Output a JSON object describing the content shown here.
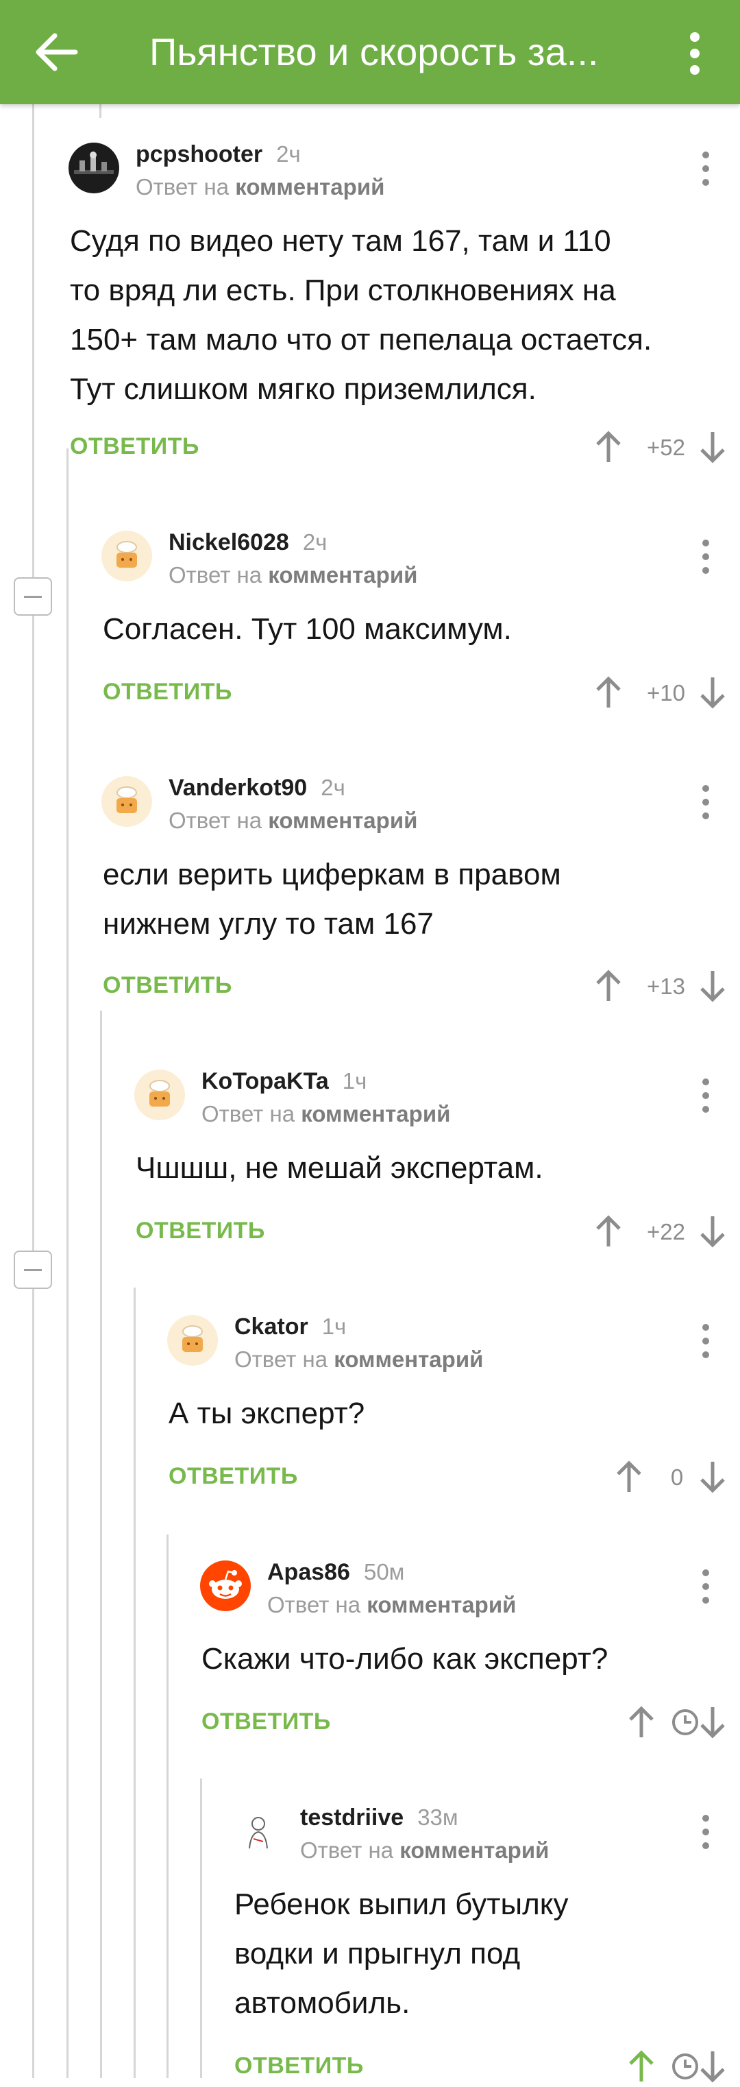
{
  "header": {
    "title": "Пьянство и скорость за...",
    "back_icon": "arrow-left-icon",
    "menu_icon": "more-vertical-icon",
    "color": "#6fae45"
  },
  "colors": {
    "accent": "#78b94c",
    "muted": "#9b9b9b",
    "line": "#d6d6d6"
  },
  "comments": [
    {
      "author": "pcpshooter",
      "time": "2ч",
      "reply_prefix": "Ответ на",
      "reply_link": "комментарий",
      "body": [
        "Судя по видео нету там 167, там и 110",
        "то вряд ли есть. При столкновениях на",
        "150+ там мало что от пепелаца остается.",
        "Тут слишком мягко приземлился."
      ],
      "action": "ОТВЕТИТЬ",
      "score": "+52"
    },
    {
      "author": "Nickel6028",
      "time": "2ч",
      "reply_prefix": "Ответ на",
      "reply_link": "комментарий",
      "body": [
        "Согласен. Тут 100 максимум."
      ],
      "action": "ОТВЕТИТЬ",
      "score": "+10"
    },
    {
      "author": "Vanderkot90",
      "time": "2ч",
      "reply_prefix": "Ответ на",
      "reply_link": "комментарий",
      "body": [
        "если верить циферкам в правом",
        "нижнем углу то там 167"
      ],
      "action": "ОТВЕТИТЬ",
      "score": "+13"
    },
    {
      "author": "KoTopaKTa",
      "time": "1ч",
      "reply_prefix": "Ответ на",
      "reply_link": "комментарий",
      "body": [
        "Чшшш, не мешай экспертам."
      ],
      "action": "ОТВЕТИТЬ",
      "score": "+22"
    },
    {
      "author": "Ckator",
      "time": "1ч",
      "reply_prefix": "Ответ на",
      "reply_link": "комментарий",
      "body": [
        "А ты эксперт?"
      ],
      "action": "ОТВЕТИТЬ",
      "score": "0"
    },
    {
      "author": "Apas86",
      "time": "50м",
      "reply_prefix": "Ответ на",
      "reply_link": "комментарий",
      "body": [
        "Скажи что-либо как эксперт?"
      ],
      "action": "ОТВЕТИТЬ",
      "score_icon": "clock-icon"
    },
    {
      "author": "testdriive",
      "time": "33м",
      "reply_prefix": "Ответ на",
      "reply_link": "комментарий",
      "body": [
        "Ребенок выпил бутылку",
        "водки и прыгнул под",
        "автомобиль."
      ],
      "action": "ОТВЕТИТЬ",
      "score_icon": "clock-icon"
    }
  ]
}
